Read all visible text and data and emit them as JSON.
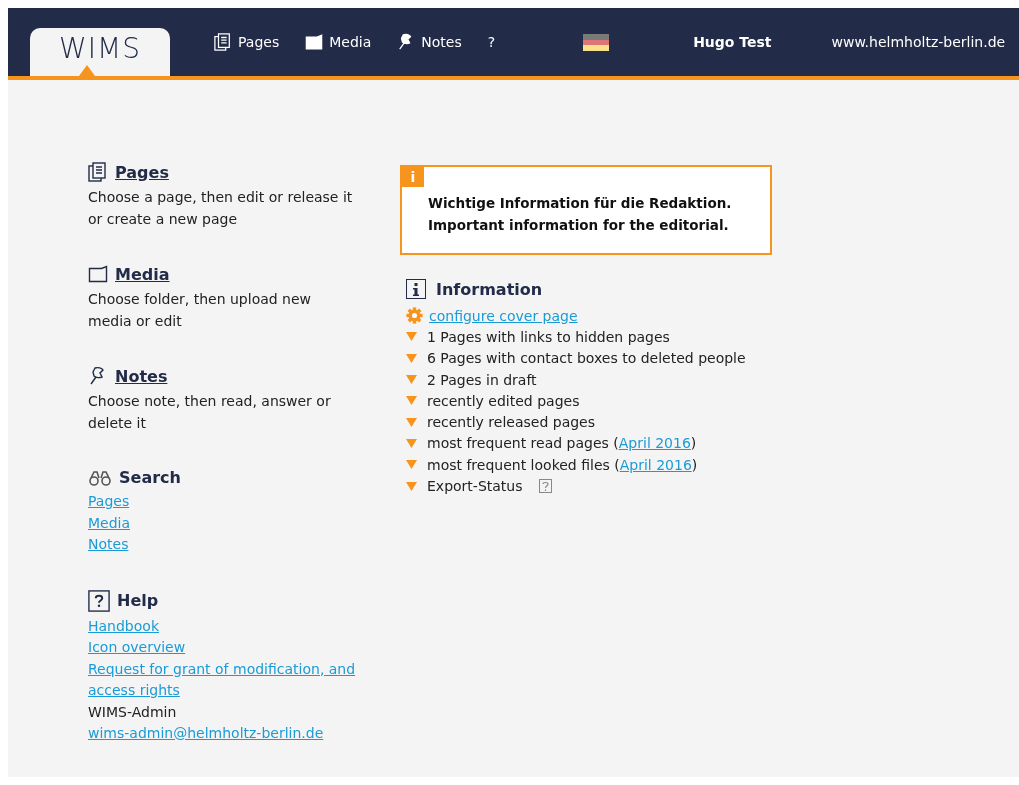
{
  "header": {
    "logo": "WIMS",
    "nav": [
      {
        "label": "Pages"
      },
      {
        "label": "Media"
      },
      {
        "label": "Notes"
      },
      {
        "label": "?"
      }
    ],
    "user": "Hugo Test",
    "site": "www.helmholtz-berlin.de"
  },
  "sections": [
    {
      "title": "Pages",
      "kind": "described",
      "description": "Choose a page, then edit or release it or create a new page"
    },
    {
      "title": "Media",
      "kind": "described",
      "description": "Choose folder, then upload new media or edit"
    },
    {
      "title": "Notes",
      "kind": "described",
      "description": "Choose note, then read, answer or delete it"
    },
    {
      "title": "Search",
      "kind": "links",
      "items": [
        {
          "kind": "link",
          "text": "Pages"
        },
        {
          "kind": "link",
          "text": "Media"
        },
        {
          "kind": "link",
          "text": "Notes"
        }
      ]
    },
    {
      "title": "Help",
      "kind": "links",
      "items": [
        {
          "kind": "link",
          "text": "Handbook"
        },
        {
          "kind": "link",
          "text": "Icon overview"
        },
        {
          "kind": "link",
          "text": "Request for grant of modification, and access rights"
        },
        {
          "kind": "text",
          "text": "WIMS-Admin"
        },
        {
          "kind": "link",
          "text": "wims-admin@helmholtz-berlin.de"
        }
      ]
    }
  ],
  "notice": {
    "badge": "i",
    "lines": [
      "Wichtige Information für die Redaktion.",
      "Important information for the editorial."
    ]
  },
  "information": {
    "title": "Information",
    "items": [
      {
        "kind": "config",
        "text": " configure cover page"
      },
      {
        "kind": "expandable",
        "text": "1 Pages with links to hidden pages"
      },
      {
        "kind": "expandable",
        "text": "6 Pages with contact boxes to deleted people"
      },
      {
        "kind": "expandable",
        "text": "2 Pages in draft"
      },
      {
        "kind": "expandable",
        "text": "recently edited pages"
      },
      {
        "kind": "expandable",
        "text": "recently released pages"
      },
      {
        "kind": "expandable",
        "text": "most frequent read pages (",
        "link": "April 2016",
        "suffix": ")"
      },
      {
        "kind": "expandable",
        "text": "most frequent looked files (",
        "link": "April 2016",
        "suffix": ")"
      },
      {
        "kind": "status",
        "text": "Export-Status"
      }
    ]
  }
}
